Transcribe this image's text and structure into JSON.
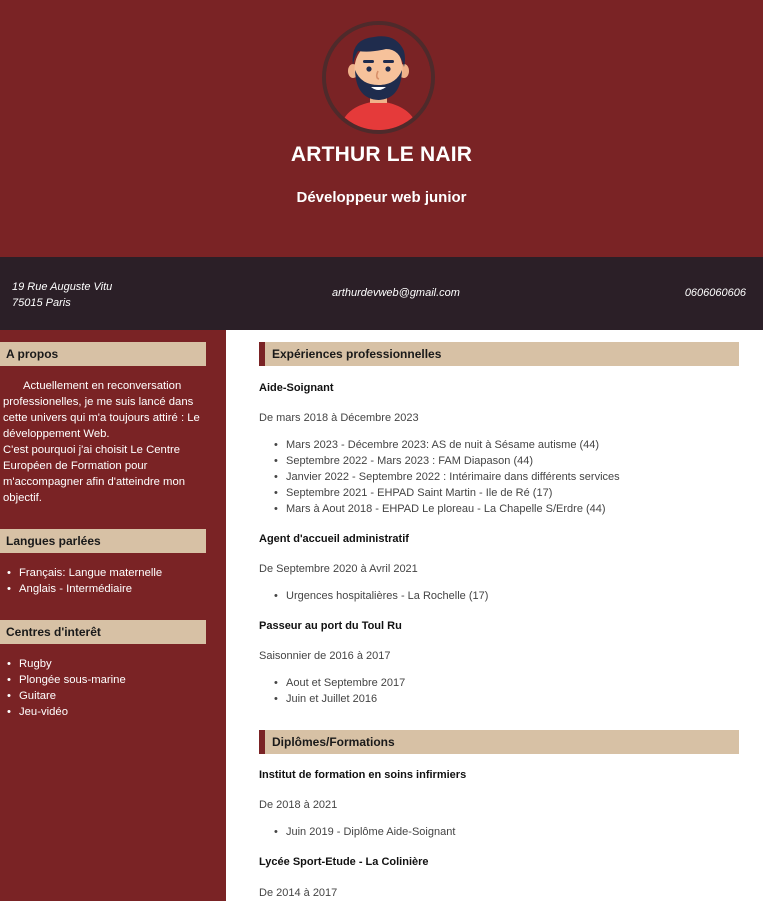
{
  "header": {
    "name": "ARTHUR LE NAIR",
    "job_title": "Développeur web junior"
  },
  "contact": {
    "address_line1": "19 Rue Auguste Vitu",
    "address_line2": "75015 Paris",
    "email": "arthurdevweb@gmail.com",
    "phone": "0606060606"
  },
  "sidebar": {
    "about_title": "A propos",
    "about_p1": "Actuellement en reconversation professionelles, je me suis lancé dans cette univers qui m'a toujours attiré : Le développement Web.",
    "about_p2": "C'est pourquoi j'ai choisit Le Centre Européen de Formation pour m'accompagner afin d'atteindre mon objectif.",
    "languages_title": "Langues parlées",
    "languages": [
      "Français: Langue maternelle",
      "Anglais - Intermédiaire"
    ],
    "interests_title": "Centres d'interêt",
    "interests": [
      "Rugby",
      "Plongée sous-marine",
      "Guitare",
      "Jeu-vidéo"
    ]
  },
  "experience": {
    "title": "Expériences professionnelles",
    "jobs": [
      {
        "title": "Aide-Soignant",
        "dates": "De mars 2018 à Décembre 2023",
        "items": [
          "Mars 2023 - Décembre 2023: AS de nuit à Sésame autisme (44)",
          "Septembre 2022 - Mars 2023 : FAM Diapason (44)",
          "Janvier 2022 - Septembre 2022 : Intérimaire dans différents services",
          "Septembre 2021 - EHPAD Saint Martin - Ile de Ré (17)",
          "Mars à Aout 2018 - EHPAD Le ploreau - La Chapelle S/Erdre (44)"
        ]
      },
      {
        "title": "Agent d'accueil administratif",
        "dates": "De Septembre 2020 à Avril 2021",
        "items": [
          "Urgences hospitalières - La Rochelle (17)"
        ]
      },
      {
        "title": "Passeur au port du Toul Ru",
        "dates": "Saisonnier de 2016 à 2017",
        "items": [
          "Aout et Septembre 2017",
          "Juin et Juillet 2016"
        ]
      }
    ]
  },
  "education": {
    "title": "Diplômes/Formations",
    "schools": [
      {
        "title": "Institut de formation en soins infirmiers",
        "dates": "De 2018 à 2021",
        "items": [
          "Juin 2019 - Diplôme Aide-Soignant"
        ]
      },
      {
        "title": "Lycée Sport-Etude - La Colinière",
        "dates": "De 2014 à 2017"
      }
    ]
  },
  "icons": {
    "avatar": "bearded-man-avatar"
  },
  "colors": {
    "primary": "#7a2325",
    "dark": "#2b1f27",
    "beige": "#d7c1a5"
  }
}
